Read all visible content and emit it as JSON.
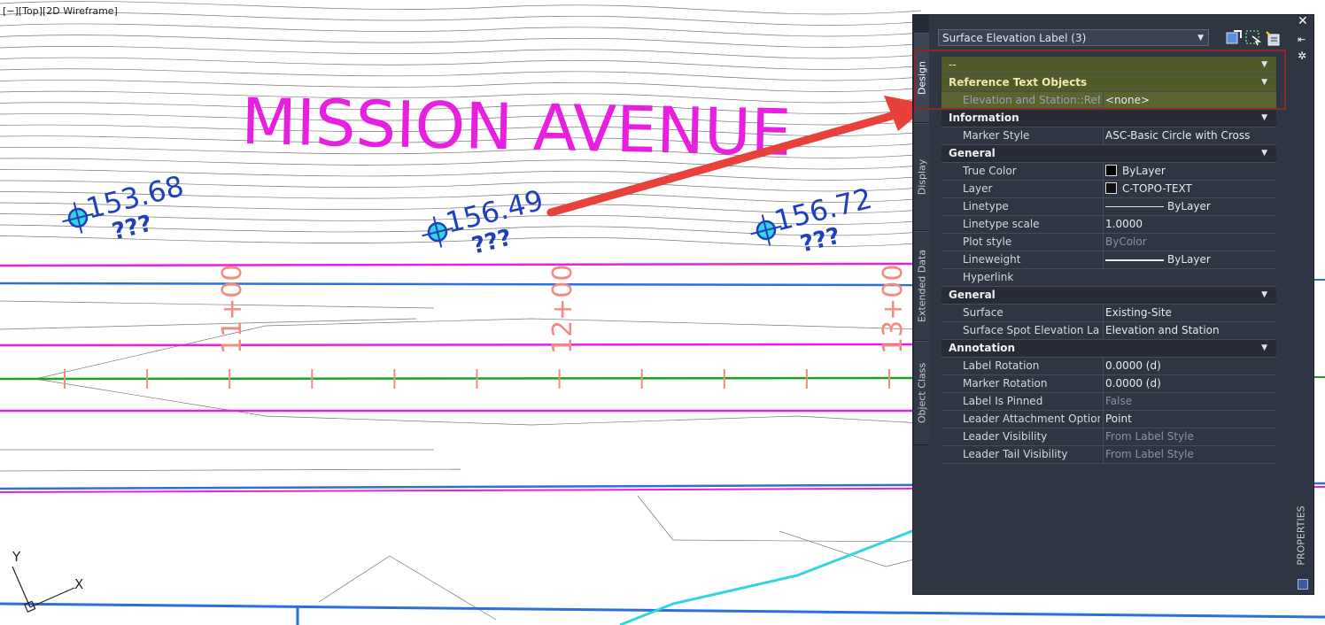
{
  "viewport": {
    "label": "[−][Top][2D Wireframe]"
  },
  "drawing": {
    "street_name": "MISSION AVENUE",
    "stations": [
      "11+00",
      "12+00",
      "13+00"
    ],
    "spot_labels": [
      {
        "elevation": "153.68",
        "station": "???"
      },
      {
        "elevation": "156.49",
        "station": "???"
      },
      {
        "elevation": "156.72",
        "station": "???"
      }
    ],
    "ucs": {
      "x": "X",
      "y": "Y"
    },
    "colors": {
      "street": "#e81fe0",
      "labels": "#1f3fbf",
      "stations": "#f08c80",
      "arrow": "#e8403a"
    }
  },
  "palette": {
    "selector": "Surface Elevation Label (3)",
    "side_tabs": [
      "Design",
      "Display",
      "Extended Data",
      "Object Class"
    ],
    "title_tab": "PROPERTIES",
    "close": "✕",
    "top_row": {
      "name": "--"
    },
    "reference": {
      "title": "Reference Text Objects",
      "row": {
        "name": "Elevation and Station::Refe...",
        "value": "<none>"
      }
    },
    "information": {
      "title": "Information",
      "rows": [
        {
          "name": "Marker Style",
          "value": "ASC-Basic Circle with Cross"
        }
      ]
    },
    "general1": {
      "title": "General",
      "rows": [
        {
          "name": "True Color",
          "value": "ByLayer"
        },
        {
          "name": "Layer",
          "value": "C-TOPO-TEXT"
        },
        {
          "name": "Linetype",
          "value": "ByLayer"
        },
        {
          "name": "Linetype scale",
          "value": "1.0000"
        },
        {
          "name": "Plot style",
          "value": "ByColor"
        },
        {
          "name": "Lineweight",
          "value": "ByLayer"
        },
        {
          "name": "Hyperlink",
          "value": ""
        }
      ]
    },
    "general2": {
      "title": "General",
      "rows": [
        {
          "name": "Surface",
          "value": "Existing-Site"
        },
        {
          "name": "Surface Spot Elevation Lab...",
          "value": "Elevation and Station"
        }
      ]
    },
    "annotation": {
      "title": "Annotation",
      "rows": [
        {
          "name": "Label Rotation",
          "value": "0.0000 (d)"
        },
        {
          "name": "Marker Rotation",
          "value": "0.0000 (d)"
        },
        {
          "name": "Label Is Pinned",
          "value": "False"
        },
        {
          "name": "Leader Attachment Option",
          "value": "Point"
        },
        {
          "name": "Leader Visibility",
          "value": "From Label Style"
        },
        {
          "name": "Leader Tail Visibility",
          "value": "From Label Style"
        }
      ]
    }
  }
}
